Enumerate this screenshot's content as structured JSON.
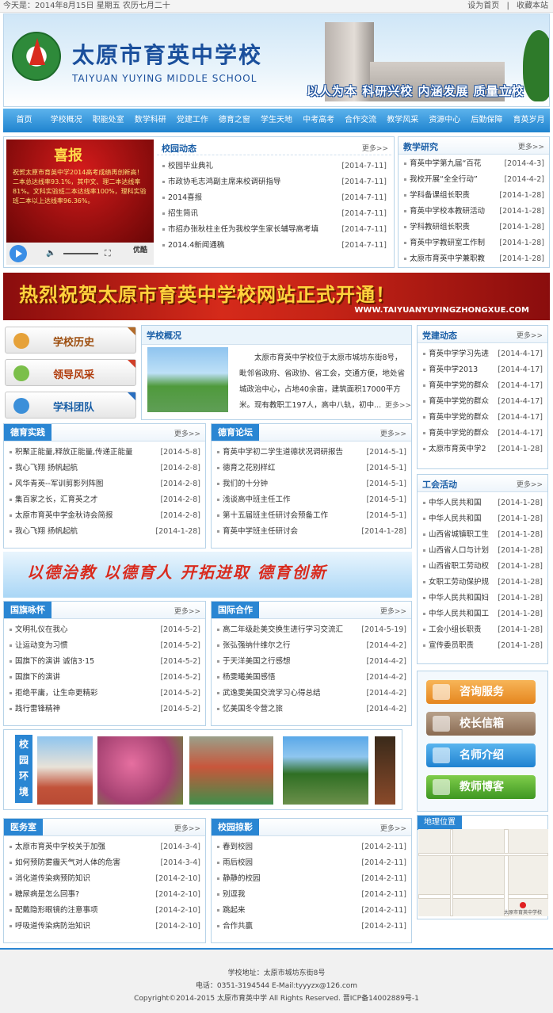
{
  "topbar": {
    "date": "今天是：2014年8月15日  星期五  农历七月二十",
    "set_home": "设为首页",
    "favorite": "收藏本站"
  },
  "header": {
    "school_cn": "太原市育英中学校",
    "school_en": "TAIYUAN YUYING MIDDLE SCHOOL",
    "slogan": "以人为本 科研兴校 内涵发展 质量立校"
  },
  "nav": [
    "首页",
    "学校概况",
    "职能处室",
    "数学科研",
    "党建工作",
    "德育之窗",
    "学生天地",
    "中考高考",
    "合作交流",
    "教学风采",
    "资源中心",
    "后勤保障",
    "育英岁月"
  ],
  "video": {
    "xibao": "喜报",
    "text": "祝贺太原市育英中学2014高考成绩再创新高！二本总达线率93.1%，其中文、理二本达线率81%。文科实验班二本达线率100%，理科实验班二本以上达线率96.36%。",
    "brand": "优酷"
  },
  "school_news": {
    "title": "校园动态",
    "more": "更多>>",
    "items": [
      {
        "t": "校园毕业典礼",
        "d": "[2014-7-11]"
      },
      {
        "t": "市政协毛志鸿副主席来校调研指导",
        "d": "[2014-7-11]"
      },
      {
        "t": "2014喜报",
        "d": "[2014-7-11]"
      },
      {
        "t": "招生简讯",
        "d": "[2014-7-11]"
      },
      {
        "t": "市招办张秋柱主任为我校学生家长辅导高考填",
        "d": "[2014-7-11]"
      },
      {
        "t": "2014.4新闻通稿",
        "d": "[2014-7-11]"
      }
    ]
  },
  "research": {
    "title": "教学研究",
    "more": "更多>>",
    "items": [
      {
        "t": "育英中学第九届“百花",
        "d": "[2014-4-3]"
      },
      {
        "t": "我校开展“全全行动”",
        "d": "[2014-4-2]"
      },
      {
        "t": "学科备课组长职责",
        "d": "[2014-1-28]"
      },
      {
        "t": "育英中学校本教研活动",
        "d": "[2014-1-28]"
      },
      {
        "t": "学科教研组长职责",
        "d": "[2014-1-28]"
      },
      {
        "t": "育英中学教研室工作制",
        "d": "[2014-1-28]"
      },
      {
        "t": "太原市育英中学兼职教",
        "d": "[2014-1-28]"
      }
    ]
  },
  "ad": {
    "text": "热烈祝贺太原市育英中学校网站正式开通！",
    "url": "WWW.TAIYUANYUYINGZHONGXUE.COM"
  },
  "side_buttons": [
    "学校历史",
    "领导风采",
    "学科团队"
  ],
  "intro": {
    "title": "学校概况",
    "text": "太原市育英中学校位于太原市城坊东街8号，毗邻省政府、省政协、省工会，交通方便，地处省城政治中心，占地40余亩，建筑面积17000平方米。现有教职工197人，高中八轨，初中...",
    "more": "更多>>"
  },
  "party": {
    "title": "党建动态",
    "more": "更多>>",
    "items": [
      {
        "t": "育英中学学习先进",
        "d": "[2014-4-17]"
      },
      {
        "t": "育英中学2013",
        "d": "[2014-4-17]"
      },
      {
        "t": "育英中学党的群众",
        "d": "[2014-4-17]"
      },
      {
        "t": "育英中学党的群众",
        "d": "[2014-4-17]"
      },
      {
        "t": "育英中学党的群众",
        "d": "[2014-4-17]"
      },
      {
        "t": "育英中学党的群众",
        "d": "[2014-4-17]"
      },
      {
        "t": "太原市育英中学2",
        "d": "[2014-1-28]"
      }
    ]
  },
  "moral_practice": {
    "title": "德育实践",
    "more": "更多>>",
    "items": [
      {
        "t": "积聚正能量,释放正能量,传递正能量",
        "d": "[2014-5-8]"
      },
      {
        "t": "我心飞翔 扬帆起航",
        "d": "[2014-2-8]"
      },
      {
        "t": "风华青英--军训剪影列阵图",
        "d": "[2014-2-8]"
      },
      {
        "t": "集百家之长，汇育英之才",
        "d": "[2014-2-8]"
      },
      {
        "t": "太原市育英中学金秋诗会简报",
        "d": "[2014-2-8]"
      },
      {
        "t": "我心飞翔 扬帆起航",
        "d": "[2014-1-28]"
      }
    ]
  },
  "moral_forum": {
    "title": "德育论坛",
    "more": "更多>>",
    "items": [
      {
        "t": "育英中学初二学生道德状况调研报告",
        "d": "[2014-5-1]"
      },
      {
        "t": "德育之花别样红",
        "d": "[2014-5-1]"
      },
      {
        "t": "我们的十分钟",
        "d": "[2014-5-1]"
      },
      {
        "t": "浅谈高中班主任工作",
        "d": "[2014-5-1]"
      },
      {
        "t": "第十五届班主任研讨会预备工作",
        "d": "[2014-5-1]"
      },
      {
        "t": "育英中学班主任研讨会",
        "d": "[2014-1-28]"
      }
    ]
  },
  "union": {
    "title": "工会活动",
    "more": "更多>>",
    "items": [
      {
        "t": "中华人民共和国",
        "d": "[2014-1-28]"
      },
      {
        "t": "中华人民共和国",
        "d": "[2014-1-28]"
      },
      {
        "t": "山西省城镇职工生",
        "d": "[2014-1-28]"
      },
      {
        "t": "山西省人口与计划",
        "d": "[2014-1-28]"
      },
      {
        "t": "山西省职工劳动权",
        "d": "[2014-1-28]"
      },
      {
        "t": "女职工劳动保护规",
        "d": "[2014-1-28]"
      },
      {
        "t": "中华人民共和国妇",
        "d": "[2014-1-28]"
      },
      {
        "t": "中华人民共和国工",
        "d": "[2014-1-28]"
      },
      {
        "t": "工会小组长职责",
        "d": "[2014-1-28]"
      },
      {
        "t": "宣传委员职责",
        "d": "[2014-1-28]"
      }
    ]
  },
  "slogan2": "以德治教  以德育人  开拓进取  德育创新",
  "flag": {
    "title": "国旗咏怀",
    "more": "更多>>",
    "items": [
      {
        "t": "文明礼仪在我心",
        "d": "[2014-5-2]"
      },
      {
        "t": "让运动变为习惯",
        "d": "[2014-5-2]"
      },
      {
        "t": "国旗下的演讲 诚信3·15",
        "d": "[2014-5-2]"
      },
      {
        "t": "国旗下的演讲",
        "d": "[2014-5-2]"
      },
      {
        "t": "拒绝平庸，让生命更精彩",
        "d": "[2014-5-2]"
      },
      {
        "t": "践行雷锋精神",
        "d": "[2014-5-2]"
      }
    ]
  },
  "intl": {
    "title": "国际合作",
    "more": "更多>>",
    "items": [
      {
        "t": "高二年级赴美交换生进行学习交流汇",
        "d": "[2014-5-19]"
      },
      {
        "t": "张弘强纳什维尔之行",
        "d": "[2014-4-2]"
      },
      {
        "t": "于天洋美国之行感想",
        "d": "[2014-4-2]"
      },
      {
        "t": "杨雯曦美国感悟",
        "d": "[2014-4-2]"
      },
      {
        "t": "武逸雯美国交流学习心得总结",
        "d": "[2014-4-2]"
      },
      {
        "t": "忆美国冬令营之旅",
        "d": "[2014-4-2]"
      }
    ]
  },
  "env_label": "校园环境",
  "services": [
    "咨询服务",
    "校长信箱",
    "名师介绍",
    "教师博客"
  ],
  "clinic": {
    "title": "医务室",
    "more": "更多>>",
    "items": [
      {
        "t": "太原市育英中学校关于加强",
        "d": "[2014-3-4]"
      },
      {
        "t": "如何预防雾霾天气对人体的危害",
        "d": "[2014-3-4]"
      },
      {
        "t": "消化道传染病预防知识",
        "d": "[2014-2-10]"
      },
      {
        "t": "糖尿病是怎么回事?",
        "d": "[2014-2-10]"
      },
      {
        "t": "配戴隐形眼镜的注意事项",
        "d": "[2014-2-10]"
      },
      {
        "t": "呼吸道传染病防治知识",
        "d": "[2014-2-10]"
      }
    ]
  },
  "snap": {
    "title": "校园掠影",
    "more": "更多>>",
    "items": [
      {
        "t": "春到校园",
        "d": "[2014-2-11]"
      },
      {
        "t": "雨后校园",
        "d": "[2014-2-11]"
      },
      {
        "t": "静静的校园",
        "d": "[2014-2-11]"
      },
      {
        "t": "别逗我",
        "d": "[2014-2-11]"
      },
      {
        "t": "跳起来",
        "d": "[2014-2-11]"
      },
      {
        "t": "合作共赢",
        "d": "[2014-2-11]"
      }
    ]
  },
  "map": {
    "title": "地理位置",
    "pin_label": "太原市育英中学校"
  },
  "footer": {
    "address": "学校地址：太原市城坊东街8号",
    "contact": "电话：0351-3194544 E-Mail:tyyyzx@126.com",
    "copyright": "Copyright©2014-2015 太原市育英中学 All Rights Reserved. 晋ICP备14002889号-1"
  }
}
